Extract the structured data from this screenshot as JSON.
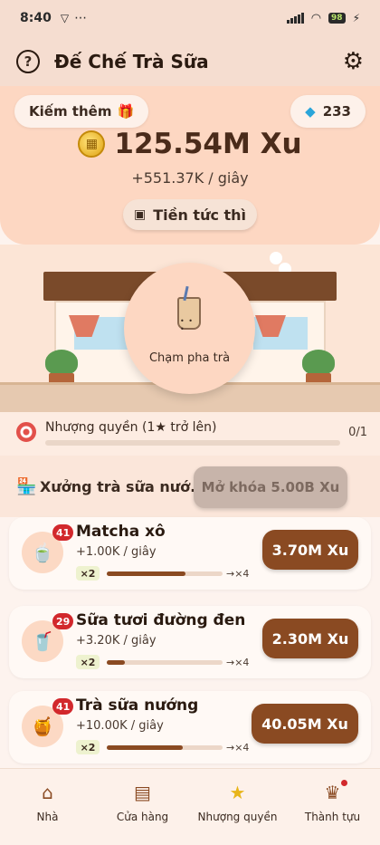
{
  "status": {
    "time": "8:40",
    "battery": "98",
    "extra": "⋯"
  },
  "app": {
    "title": "Đế Chế Trà Sữa",
    "help_icon": "help-icon",
    "settings_icon": "gear-icon"
  },
  "wallet": {
    "earn_more_label": "Kiếm thêm",
    "gift_icon": "🎁",
    "gems": "233",
    "balance": "125.54M Xu",
    "rate": "+551.37K / giây",
    "instant_label": "Tiền tức thì"
  },
  "scene": {
    "tap_label": "Chạm pha trà"
  },
  "franchise": {
    "label": "Nhượng quyền (1★ trở lên)",
    "count": "0/1",
    "progress": 0
  },
  "section": {
    "icon": "🏪",
    "title": "Xưởng trà sữa nướ...",
    "unlock_label": "Mở khóa 5.00B Xu"
  },
  "drinks": [
    {
      "name": "Matcha xô",
      "level": "41",
      "rate": "+1.00K / giây",
      "mult": "×2",
      "next": "→×4",
      "price": "3.70M Xu",
      "progress": 0.68,
      "icon": "🍵"
    },
    {
      "name": "Sữa tươi đường đen",
      "level": "29",
      "rate": "+3.20K / giây",
      "mult": "×2",
      "next": "→×4",
      "price": "2.30M Xu",
      "progress": 0.16,
      "icon": "🥤"
    },
    {
      "name": "Trà sữa nướng",
      "level": "41",
      "rate": "+10.00K / giây",
      "mult": "×2",
      "next": "→×4",
      "price": "40.05M Xu",
      "progress": 0.66,
      "icon": "🍯"
    }
  ],
  "nav": [
    {
      "label": "Nhà",
      "icon": "home-icon"
    },
    {
      "label": "Cửa hàng",
      "icon": "store-icon"
    },
    {
      "label": "Nhượng quyền",
      "icon": "star-icon"
    },
    {
      "label": "Thành tựu",
      "icon": "trophy-icon"
    }
  ]
}
